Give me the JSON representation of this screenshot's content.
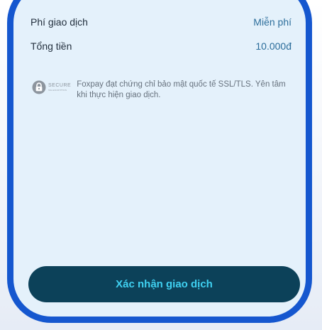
{
  "fee_row": {
    "label": "Phí giao dịch",
    "value": "Miễn phí"
  },
  "total_row": {
    "label": "Tổng tiền",
    "value": "10.000đ"
  },
  "security": {
    "logo_text": "SECURE",
    "logo_subtext": "SSL ENCRYPTION",
    "message": "Foxpay đạt chứng chỉ bảo mật quốc tế SSL/TLS. Yên tâm khi thực hiện giao dịch."
  },
  "confirm_button": {
    "label": "Xác nhận giao dịch"
  },
  "colors": {
    "frame_border": "#1557cf",
    "panel_background": "#e4f1fb",
    "button_background": "#0c4159",
    "button_text": "#3fd0f1",
    "amount_text": "#2a6c9a"
  }
}
